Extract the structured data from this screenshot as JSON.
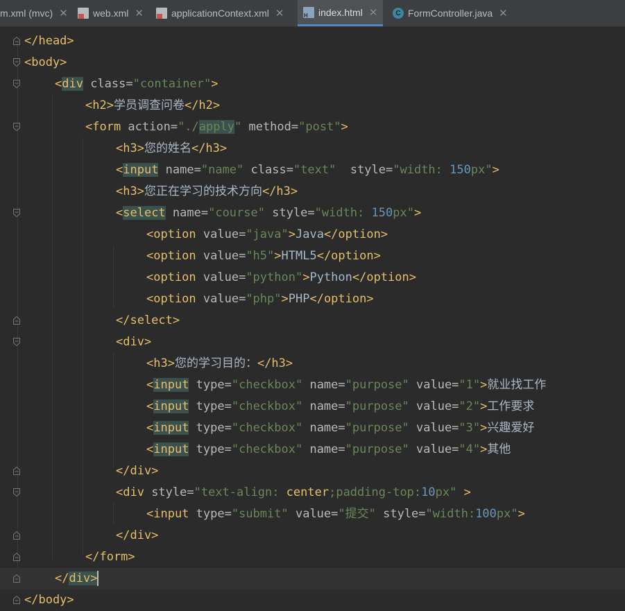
{
  "tabs": [
    {
      "label": "m.xml (mvc)",
      "icon": "xml-file-icon",
      "active": false
    },
    {
      "label": "web.xml",
      "icon": "xml-file-icon",
      "active": false
    },
    {
      "label": "applicationContext.xml",
      "icon": "xml-file-icon",
      "active": false
    },
    {
      "label": "index.html",
      "icon": "html-file-icon",
      "active": true
    },
    {
      "label": "FormController.java",
      "icon": "java-class-icon",
      "active": false
    }
  ],
  "close_glyph": "✕",
  "java_icon_letter": "C",
  "lines": [
    [
      [
        "t",
        "</head>"
      ]
    ],
    [
      [
        "t",
        "<body>"
      ]
    ],
    [
      [
        "t",
        "<"
      ],
      [
        "t hl",
        "div"
      ],
      [
        "a",
        " class="
      ],
      [
        "v",
        "\"container\""
      ],
      [
        "t",
        ">"
      ]
    ],
    [
      [
        "t",
        "<h2>"
      ],
      [
        "x",
        "学员调查问卷"
      ],
      [
        "t",
        "</h2>"
      ]
    ],
    [
      [
        "t",
        "<form "
      ],
      [
        "a",
        "action="
      ],
      [
        "v",
        "\"./"
      ],
      [
        "v hl",
        "apply"
      ],
      [
        "v",
        "\""
      ],
      [
        "a",
        " method="
      ],
      [
        "v",
        "\"post\""
      ],
      [
        "t",
        ">"
      ]
    ],
    [
      [
        "t",
        "<h3>"
      ],
      [
        "x",
        "您的姓名"
      ],
      [
        "t",
        "</h3>"
      ]
    ],
    [
      [
        "t",
        "<"
      ],
      [
        "t hl",
        "input"
      ],
      [
        "a",
        " name="
      ],
      [
        "v",
        "\"name\""
      ],
      [
        "a",
        " class="
      ],
      [
        "v",
        "\"text\""
      ],
      [
        "a",
        "  style="
      ],
      [
        "v",
        "\"width: "
      ],
      [
        "n",
        "150"
      ],
      [
        "v",
        "px\""
      ],
      [
        "t",
        ">"
      ]
    ],
    [
      [
        "t",
        "<h3>"
      ],
      [
        "x",
        "您正在学习的技术方向"
      ],
      [
        "t",
        "</h3>"
      ]
    ],
    [
      [
        "t",
        "<"
      ],
      [
        "t hl",
        "select"
      ],
      [
        "a",
        " name="
      ],
      [
        "v",
        "\"course\""
      ],
      [
        "a",
        " style="
      ],
      [
        "v",
        "\"width: "
      ],
      [
        "n",
        "150"
      ],
      [
        "v",
        "px\""
      ],
      [
        "t",
        ">"
      ]
    ],
    [
      [
        "t",
        "<option "
      ],
      [
        "a",
        "value="
      ],
      [
        "v",
        "\"java\""
      ],
      [
        "t",
        ">"
      ],
      [
        "x",
        "Java"
      ],
      [
        "t",
        "</option>"
      ]
    ],
    [
      [
        "t",
        "<option "
      ],
      [
        "a",
        "value="
      ],
      [
        "v",
        "\"h5\""
      ],
      [
        "t",
        ">"
      ],
      [
        "x",
        "HTML5"
      ],
      [
        "t",
        "</option>"
      ]
    ],
    [
      [
        "t",
        "<option "
      ],
      [
        "a",
        "value="
      ],
      [
        "v",
        "\"python\""
      ],
      [
        "t",
        ">"
      ],
      [
        "x",
        "Python"
      ],
      [
        "t",
        "</option>"
      ]
    ],
    [
      [
        "t",
        "<option "
      ],
      [
        "a",
        "value="
      ],
      [
        "v",
        "\"php\""
      ],
      [
        "t",
        ">"
      ],
      [
        "x",
        "PHP"
      ],
      [
        "t",
        "</option>"
      ]
    ],
    [
      [
        "t",
        "</select>"
      ]
    ],
    [
      [
        "t",
        "<div>"
      ]
    ],
    [
      [
        "t",
        "<h3>"
      ],
      [
        "x",
        "您的学习目的："
      ],
      [
        "t",
        "</h3>"
      ]
    ],
    [
      [
        "t",
        "<"
      ],
      [
        "t hl",
        "input"
      ],
      [
        "a",
        " type="
      ],
      [
        "v",
        "\"checkbox\""
      ],
      [
        "a",
        " name="
      ],
      [
        "v",
        "\"purpose\""
      ],
      [
        "a",
        " value="
      ],
      [
        "v",
        "\"1\""
      ],
      [
        "t",
        ">"
      ],
      [
        "x",
        "就业找工作"
      ]
    ],
    [
      [
        "t",
        "<"
      ],
      [
        "t hl",
        "input"
      ],
      [
        "a",
        " type="
      ],
      [
        "v",
        "\"checkbox\""
      ],
      [
        "a",
        " name="
      ],
      [
        "v",
        "\"purpose\""
      ],
      [
        "a",
        " value="
      ],
      [
        "v",
        "\"2\""
      ],
      [
        "t",
        ">"
      ],
      [
        "x",
        "工作要求"
      ]
    ],
    [
      [
        "t",
        "<"
      ],
      [
        "t hl",
        "input"
      ],
      [
        "a",
        " type="
      ],
      [
        "v",
        "\"checkbox\""
      ],
      [
        "a",
        " name="
      ],
      [
        "v",
        "\"purpose\""
      ],
      [
        "a",
        " value="
      ],
      [
        "v",
        "\"3\""
      ],
      [
        "t",
        ">"
      ],
      [
        "x",
        "兴趣爱好"
      ]
    ],
    [
      [
        "t",
        "<"
      ],
      [
        "t hl",
        "input"
      ],
      [
        "a",
        " type="
      ],
      [
        "v",
        "\"checkbox\""
      ],
      [
        "a",
        " name="
      ],
      [
        "v",
        "\"purpose\""
      ],
      [
        "a",
        " value="
      ],
      [
        "v",
        "\"4\""
      ],
      [
        "t",
        ">"
      ],
      [
        "x",
        "其他"
      ]
    ],
    [
      [
        "t",
        "</div>"
      ]
    ],
    [
      [
        "t",
        "<div "
      ],
      [
        "a",
        "style="
      ],
      [
        "v",
        "\"text-align: "
      ],
      [
        "t",
        "center"
      ],
      [
        "v",
        ";padding-top:"
      ],
      [
        "n",
        "10"
      ],
      [
        "v",
        "px\""
      ],
      [
        "t",
        " >"
      ]
    ],
    [
      [
        "t",
        "<input "
      ],
      [
        "a",
        "type="
      ],
      [
        "v",
        "\"submit\""
      ],
      [
        "a",
        " value="
      ],
      [
        "v",
        "\"提交\""
      ],
      [
        "a",
        " style="
      ],
      [
        "v",
        "\"width:"
      ],
      [
        "n",
        "100"
      ],
      [
        "v",
        "px\""
      ],
      [
        "t",
        ">"
      ]
    ],
    [
      [
        "t",
        "</div>"
      ]
    ],
    [
      [
        "t",
        "</form>"
      ]
    ],
    [
      [
        "t",
        "</"
      ],
      [
        "t hl",
        "div"
      ],
      [
        "t hl",
        ">"
      ]
    ],
    [
      [
        "t",
        "</body>"
      ]
    ]
  ]
}
